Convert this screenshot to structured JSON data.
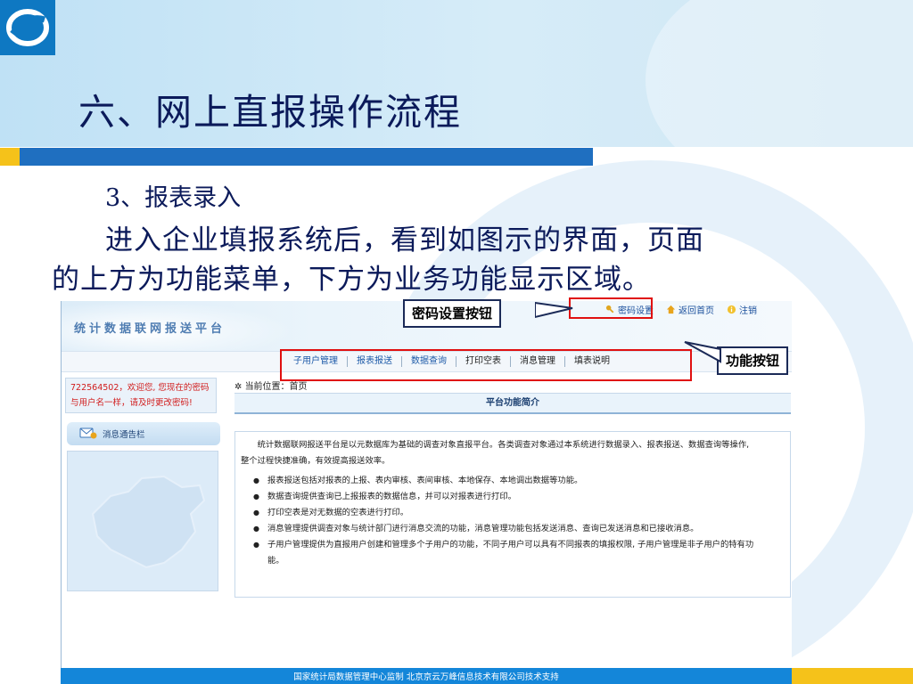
{
  "slide": {
    "title": "六、网上直报操作流程",
    "subheading": "3、报表录入",
    "body_line1": "进入企业填报系统后，看到如图示的界面，页面",
    "body_line2": "的上方为功能菜单，下方为业务功能显示区域。"
  },
  "callouts": {
    "password": "密码设置按钮",
    "functions": "功能按钮"
  },
  "screenshot": {
    "system_title": "统计数据联网报送平台",
    "top_links": [
      "密码设置",
      "返回首页",
      "注销"
    ],
    "menu": [
      "子用户管理",
      "报表报送",
      "数据查询",
      "打印空表",
      "消息管理",
      "填表说明"
    ],
    "welcome_line1": "722564502，欢迎您, 您现在的密码",
    "welcome_line2": "与用户名一样，请及时更改密码!",
    "message_board": "消息通告栏",
    "location": "当前位置：首页",
    "panel_title": "平台功能简介",
    "intro_line1": "统计数据联网报送平台是以元数据库为基础的调查对象直报平台。各类调查对象通过本系统进行数据录入、报表报送、数据查询等操作,",
    "intro_line2": "整个过程快捷准确，有效提高报送效率。",
    "bullets": [
      "报表报送包括对报表的上报、表内审核、表间审核、本地保存、本地调出数据等功能。",
      "数据查询提供查询已上报报表的数据信息，并可以对报表进行打印。",
      "打印空表是对无数据的空表进行打印。",
      "消息管理提供调查对象与统计部门进行消息交流的功能，消息管理功能包括发送消息、查询已发送消息和已接收消息。",
      "子用户管理提供为直报用户创建和管理多个子用户的功能，不同子用户可以具有不同报表的填报权限, 子用户管理是非子用户的特有功",
      "能。"
    ],
    "footer": "国家统计局数据管理中心监制   北京京云万峰信息技术有限公司技术支持"
  },
  "colors": {
    "slide_title": "#0b1a5a",
    "stripe_blue": "#1f6fc0",
    "stripe_yellow": "#f5c21a",
    "highlight_red": "#e01010",
    "footer_blue": "#1486d9"
  }
}
